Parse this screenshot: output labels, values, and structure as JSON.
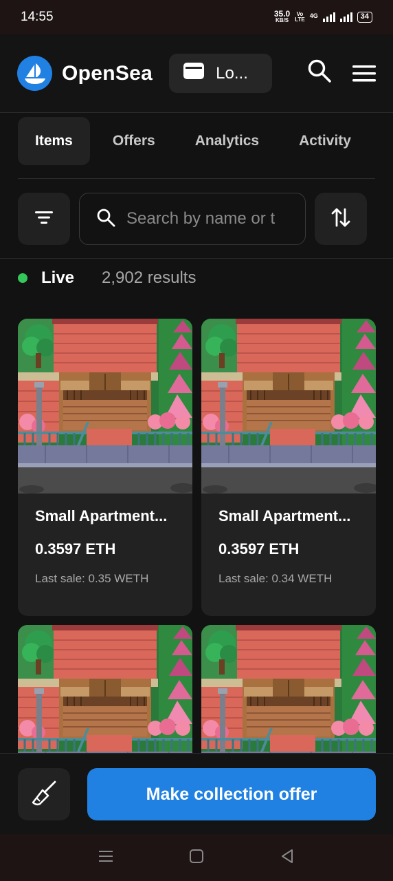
{
  "status_bar": {
    "time": "14:55",
    "net_speed_value": "35.0",
    "net_speed_unit": "KB/S",
    "volte_top": "Vo",
    "volte_bottom": "LTE",
    "network": "4G",
    "battery": "34"
  },
  "header": {
    "brand": "OpenSea",
    "login_label": "Lo...",
    "icons": [
      "opensea-logo-icon",
      "wallet-icon",
      "search-icon",
      "menu-icon"
    ]
  },
  "tabs": [
    {
      "label": "Items",
      "active": true
    },
    {
      "label": "Offers",
      "active": false
    },
    {
      "label": "Analytics",
      "active": false
    },
    {
      "label": "Activity",
      "active": false
    }
  ],
  "filters": {
    "search_placeholder": "Search by name or t",
    "icons": [
      "filter-icon",
      "search-icon",
      "sort-icon"
    ]
  },
  "results": {
    "status": "Live",
    "count": "2,902 results",
    "status_color": "#34c759"
  },
  "items": [
    {
      "name": "Small Apartment...",
      "price": "0.3597 ETH",
      "last_sale": "Last sale: 0.35 WETH"
    },
    {
      "name": "Small Apartment...",
      "price": "0.3597 ETH",
      "last_sale": "Last sale: 0.34 WETH"
    },
    {
      "name": "",
      "price": "",
      "last_sale": ""
    },
    {
      "name": "",
      "price": "",
      "last_sale": ""
    }
  ],
  "actions": {
    "offer_label": "Make collection offer",
    "accent": "#2081e2",
    "sweep_icon": "broom-icon"
  },
  "nav": {
    "icons": [
      "recents-icon",
      "home-icon",
      "back-icon"
    ]
  }
}
